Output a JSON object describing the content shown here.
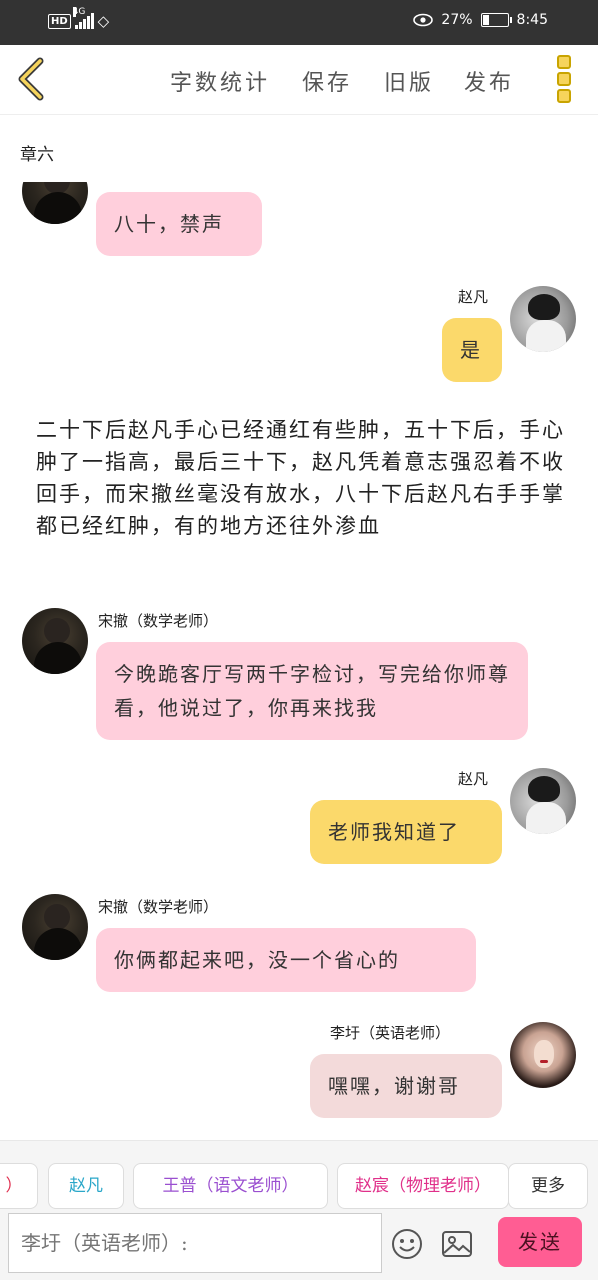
{
  "status_bar": {
    "hd": "HD",
    "network": "4G",
    "battery_text": "27%",
    "battery_level": 0.27,
    "time": "8:45"
  },
  "header": {
    "word_count": "字数统计",
    "save": "保存",
    "old_version": "旧版",
    "publish": "发布"
  },
  "chapter_title": "章六",
  "messages": [
    {
      "side": "left",
      "name": "",
      "text": "八十，禁声"
    },
    {
      "side": "right",
      "name": "赵凡",
      "text": "是"
    },
    {
      "side": "narration",
      "text": "二十下后赵凡手心已经通红有些肿，五十下后，手心肿了一指高，最后三十下，赵凡凭着意志强忍着不收回手，而宋撤丝毫没有放水，八十下后赵凡右手手掌都已经红肿，有的地方还往外渗血"
    },
    {
      "side": "left",
      "name": "宋撤（数学老师）",
      "text": "今晚跪客厅写两千字检讨，写完给你师尊看，他说过了，你再来找我"
    },
    {
      "side": "right",
      "name": "赵凡",
      "text": "老师我知道了"
    },
    {
      "side": "left",
      "name": "宋撤（数学老师）",
      "text": "你俩都起来吧，没一个省心的"
    },
    {
      "side": "right",
      "name": "李圩（英语老师）",
      "text": "嘿嘿，谢谢哥"
    }
  ],
  "characters": [
    {
      "label": "）",
      "color": "#e03050"
    },
    {
      "label": "赵凡",
      "color": "#2aa7c9"
    },
    {
      "label": "王普（语文老师）",
      "color": "#9a4fd0"
    },
    {
      "label": "赵宸（物理老师）",
      "color": "#e0308a"
    }
  ],
  "more_label": "更多",
  "input": {
    "placeholder": "李圩（英语老师）:"
  },
  "send_label": "发送"
}
